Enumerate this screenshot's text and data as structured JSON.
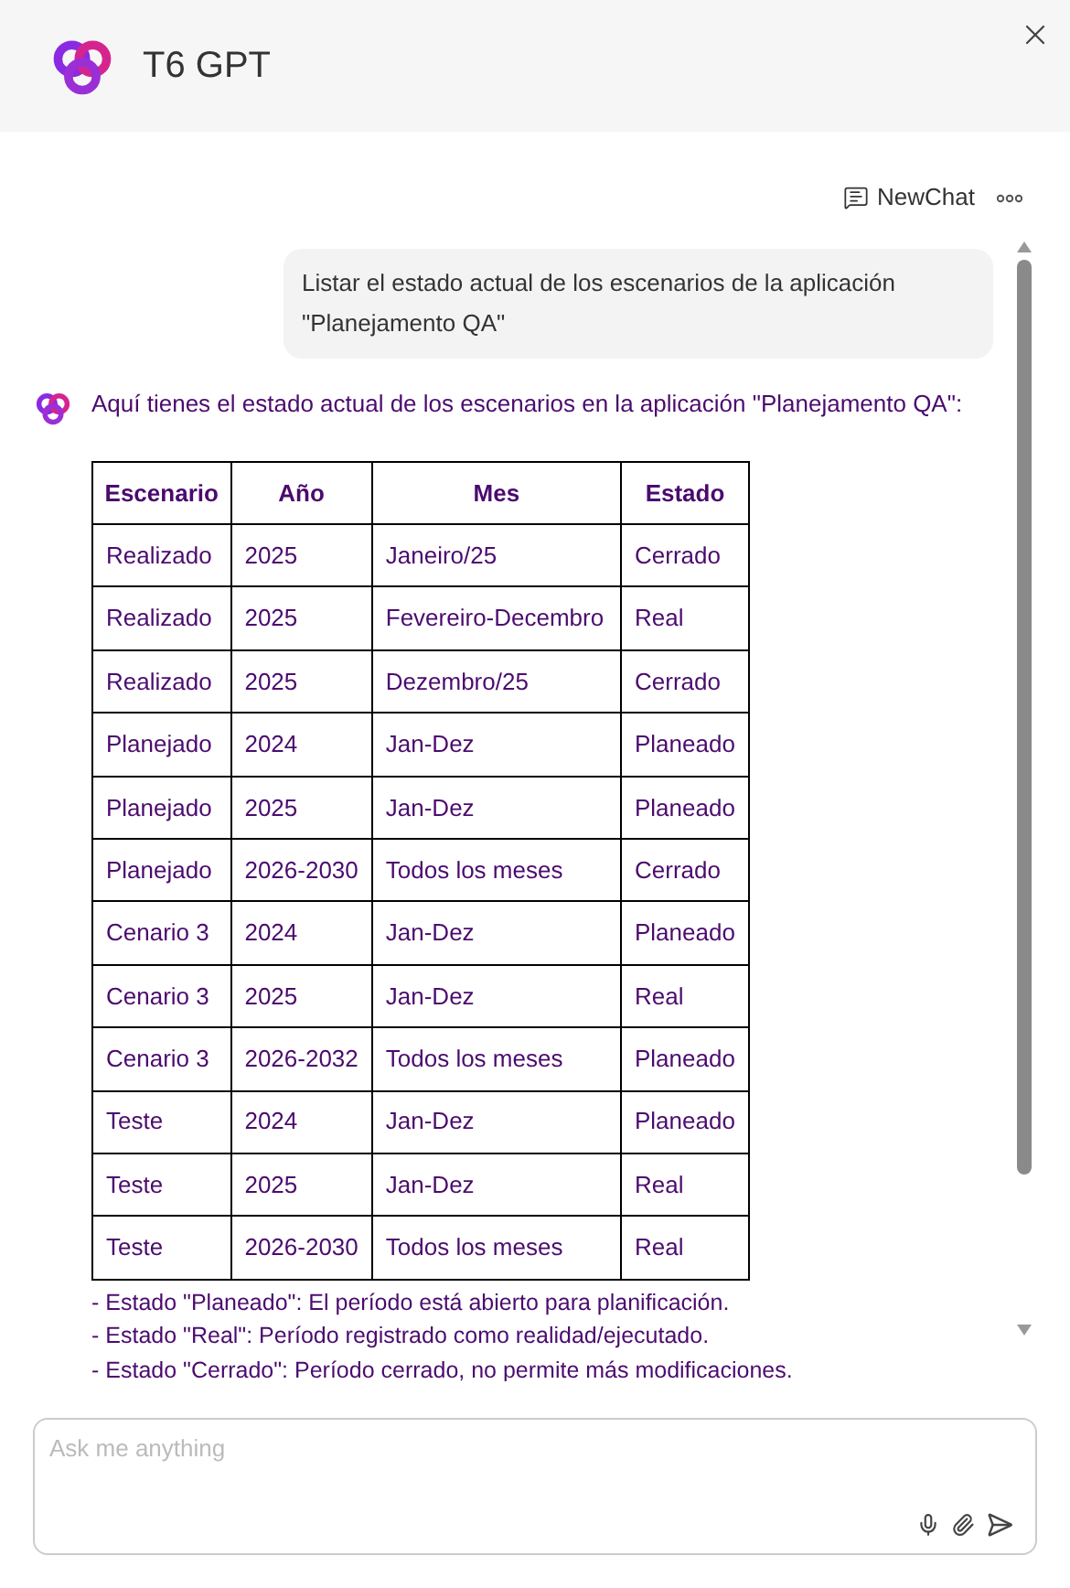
{
  "header": {
    "title": "T6 GPT"
  },
  "toolbar": {
    "new_chat": "NewChat"
  },
  "user_message": "Listar el estado actual de los escenarios de la aplicación \"Planejamento QA\"",
  "bot_message": {
    "intro": "Aquí tienes el estado actual de los escenarios en la aplicación \"Planejamento QA\":",
    "table": {
      "columns": [
        "Escenario",
        "Año",
        "Mes",
        "Estado"
      ],
      "rows": [
        [
          "Realizado",
          "2025",
          "Janeiro/25",
          "Cerrado"
        ],
        [
          "Realizado",
          "2025",
          "Fevereiro-Decembro",
          "Real"
        ],
        [
          "Realizado",
          "2025",
          "Dezembro/25",
          "Cerrado"
        ],
        [
          "Planejado",
          "2024",
          "Jan-Dez",
          "Planeado"
        ],
        [
          "Planejado",
          "2025",
          "Jan-Dez",
          "Planeado"
        ],
        [
          "Planejado",
          "2026-2030",
          "Todos los meses",
          "Cerrado"
        ],
        [
          "Cenario 3",
          "2024",
          "Jan-Dez",
          "Planeado"
        ],
        [
          "Cenario 3",
          "2025",
          "Jan-Dez",
          "Real"
        ],
        [
          "Cenario 3",
          "2026-2032",
          "Todos los meses",
          "Planeado"
        ],
        [
          "Teste",
          "2024",
          "Jan-Dez",
          "Planeado"
        ],
        [
          "Teste",
          "2025",
          "Jan-Dez",
          "Real"
        ],
        [
          "Teste",
          "2026-2030",
          "Todos los meses",
          "Real"
        ]
      ]
    },
    "notes": [
      "- Estado \"Planeado\": El período está abierto para planificación.",
      "- Estado \"Real\": Período registrado como realidad/ejecutado.",
      "- Estado \"Cerrado\": Período cerrado, no permite más modificaciones."
    ]
  },
  "input": {
    "placeholder": "Ask me anything"
  }
}
